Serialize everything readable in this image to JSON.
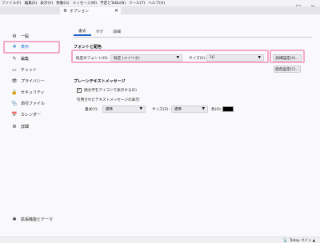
{
  "menubar": [
    "ファイル(F)",
    "編集(E)",
    "表示(V)",
    "移動(G)",
    "メッセージ(M)",
    "予定とToDo(N)",
    "ツール(T)",
    "ヘルプ(H)"
  ],
  "window_controls": {
    "minimize": "─",
    "maximize": "☐",
    "close": "✕"
  },
  "tab": {
    "icon": "⚙",
    "label": "オプション",
    "close": "✕"
  },
  "sidebar": {
    "items": [
      {
        "icon": "⚙",
        "label": "一般"
      },
      {
        "icon": "✲",
        "label": "表示"
      },
      {
        "icon": "✎",
        "label": "編集"
      },
      {
        "icon": "▭",
        "label": "チャット"
      },
      {
        "icon": "👁",
        "label": "プライバシー"
      },
      {
        "icon": "🔒",
        "label": "セキュリティ"
      },
      {
        "icon": "📎",
        "label": "添付ファイル"
      },
      {
        "icon": "📅",
        "label": "カレンダー"
      },
      {
        "icon": "⚙",
        "label": "詳細"
      }
    ],
    "addons": {
      "icon": "✱",
      "label": "拡張機能とテーマ"
    }
  },
  "subtabs": [
    "書式",
    "タグ",
    "詳細"
  ],
  "fonts": {
    "title": "フォントと配色",
    "default_font_label": "既定のフォント(D):",
    "default_font_value": "既定 (メイリオ)",
    "size_label": "サイズ(S):",
    "size_value": "16",
    "advanced_button": "詳細設定(A)...",
    "colors_button": "配色設定(C)..."
  },
  "plain": {
    "title": "プレーンテキストメッセージ",
    "emoticons_label": "顔文字をアイコンで表示する(E)",
    "emoticons_checked": true,
    "quoted_label": "引用されたテキストメッセージの表示:",
    "style_label": "書式(Y):",
    "style_value": "標準",
    "qsize_label": "サイズ(Z):",
    "qsize_value": "標準",
    "color_label": "色(O):",
    "color_value": "#000000"
  },
  "status": {
    "icon": "📡",
    "text": "Today ペイン ▲"
  }
}
